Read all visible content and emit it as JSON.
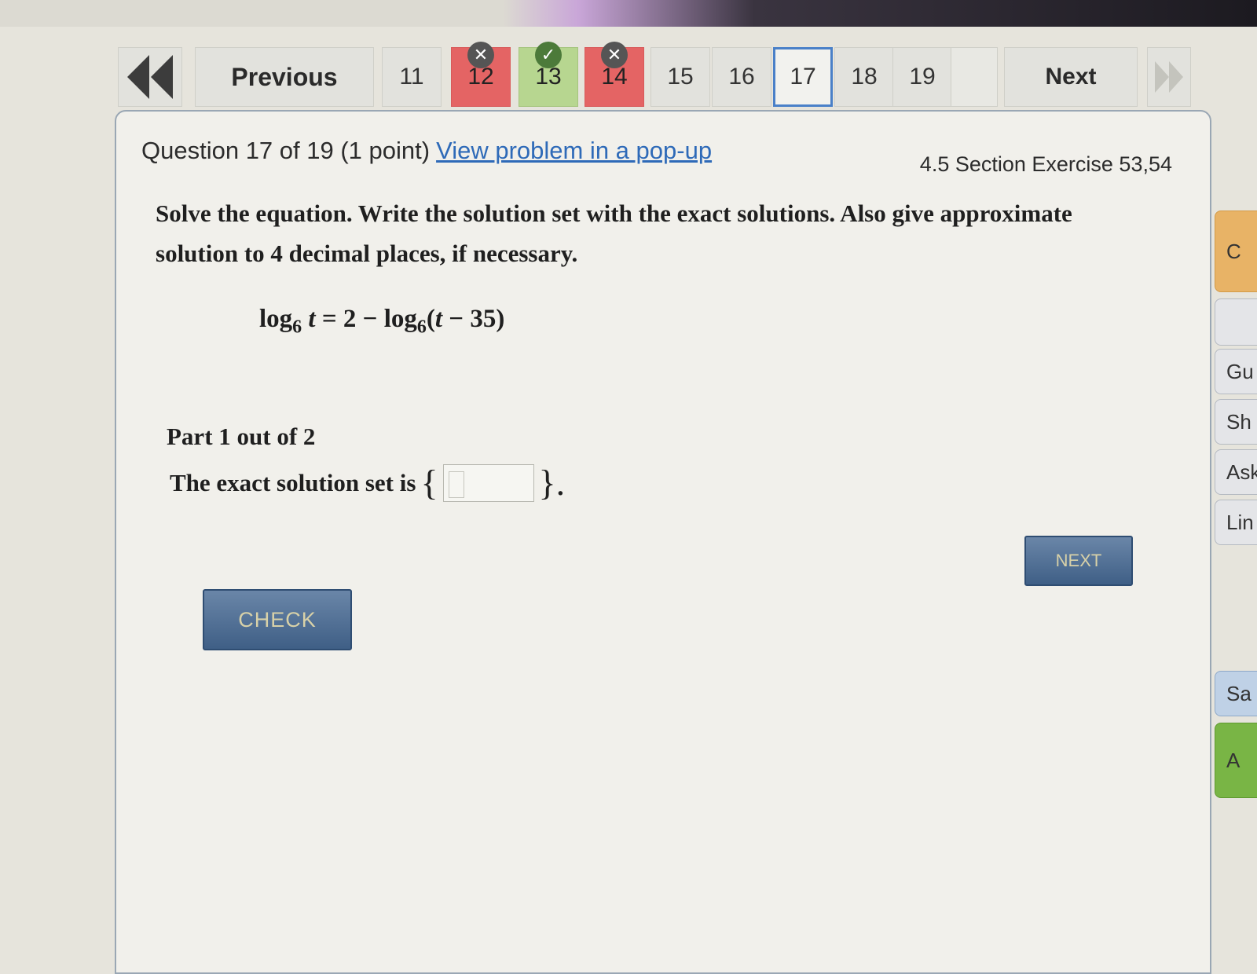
{
  "nav": {
    "previous_label": "Previous",
    "next_label": "Next",
    "questions": [
      {
        "label": "11",
        "state": "default"
      },
      {
        "label": "12",
        "state": "wrong"
      },
      {
        "label": "13",
        "state": "right"
      },
      {
        "label": "14",
        "state": "wrong"
      },
      {
        "label": "15",
        "state": "default"
      },
      {
        "label": "16",
        "state": "default"
      },
      {
        "label": "17",
        "state": "current"
      },
      {
        "label": "18",
        "state": "default"
      },
      {
        "label": "19",
        "state": "default"
      },
      {
        "label": "",
        "state": "blank"
      }
    ],
    "wrong_glyph": "✕",
    "right_glyph": "✓"
  },
  "question": {
    "header": "Question 17 of 19 (1 point)",
    "popup_link": "View problem in a pop-up",
    "section": "4.5 Section Exercise 53,54",
    "instructions": "Solve the equation. Write the solution set with the exact solutions. Also give approximate solution to 4 decimal places, if necessary.",
    "equation": {
      "lhs_fn": "log",
      "base": "6",
      "lhs_var": "t",
      "rhs_prefix": " = 2 − log",
      "rhs_arg_var": "t",
      "rhs_arg_rest": " − 35)"
    },
    "part_label": "Part 1 out of 2",
    "answer_prompt": "The exact solution set is",
    "brace_open": "{",
    "brace_close": "}.",
    "answer_value": ""
  },
  "buttons": {
    "check": "CHECK",
    "next_part": "NEXT"
  },
  "side_tools": [
    {
      "label": "C",
      "style": "orange"
    },
    {
      "label": "",
      "style": "default"
    },
    {
      "label": "Gu",
      "style": "default"
    },
    {
      "label": "Sh",
      "style": "default"
    },
    {
      "label": "Ask",
      "style": "default"
    },
    {
      "label": "Lin",
      "style": "default"
    },
    {
      "label": "Sa",
      "style": "blue"
    },
    {
      "label": "A",
      "style": "green"
    }
  ],
  "colors": {
    "wrong": "#e46464",
    "right": "#b7d690",
    "current_border": "#4a80c8",
    "link": "#2e6ab8",
    "action_button": "#4f6d92"
  }
}
